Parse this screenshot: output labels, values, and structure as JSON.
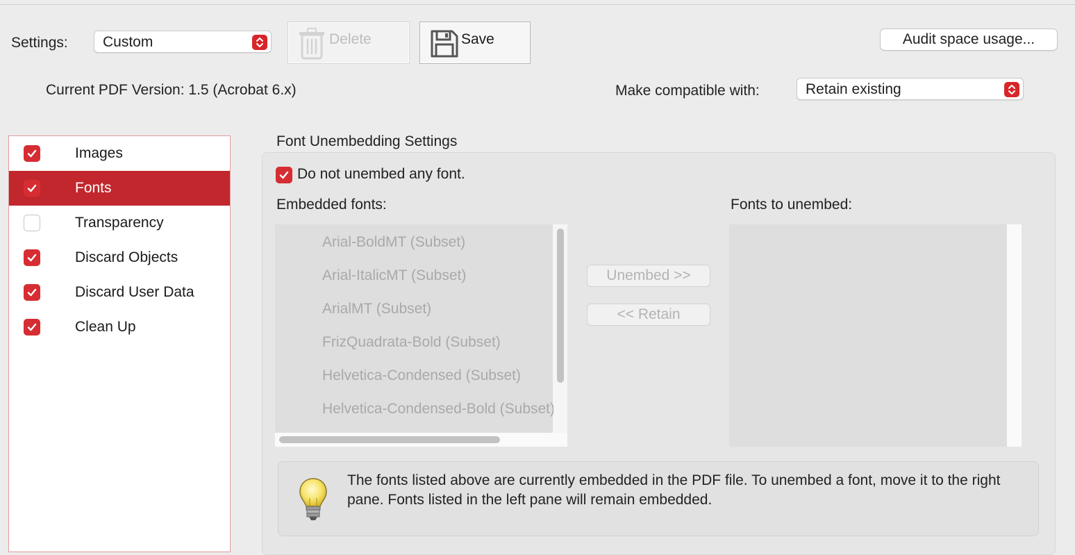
{
  "settings": {
    "label": "Settings:",
    "selected": "Custom",
    "delete_label": "Delete",
    "save_label": "Save",
    "audit_label": "Audit space usage..."
  },
  "pdf": {
    "current_version": "Current PDF Version: 1.5 (Acrobat 6.x)",
    "compat_label": "Make compatible with:",
    "compat_selected": "Retain existing"
  },
  "sidebar": {
    "items": [
      {
        "label": "Images",
        "checked": true,
        "selected": false
      },
      {
        "label": "Fonts",
        "checked": true,
        "selected": true
      },
      {
        "label": "Transparency",
        "checked": false,
        "selected": false
      },
      {
        "label": "Discard Objects",
        "checked": true,
        "selected": false
      },
      {
        "label": "Discard User Data",
        "checked": true,
        "selected": false
      },
      {
        "label": "Clean Up",
        "checked": true,
        "selected": false
      }
    ]
  },
  "fonts_panel": {
    "title": "Font Unembedding Settings",
    "do_not_unembed_label": "Do not unembed any font.",
    "do_not_unembed_checked": true,
    "embedded_label": "Embedded fonts:",
    "unembed_label": "Fonts to unembed:",
    "embedded_fonts": [
      "Arial-BoldMT (Subset)",
      "Arial-ItalicMT (Subset)",
      "ArialMT (Subset)",
      "FrizQuadrata-Bold (Subset)",
      "Helvetica-Condensed (Subset)",
      "Helvetica-Condensed-Bold (Subset)"
    ],
    "unembed_button": "Unembed >>",
    "retain_button": "<< Retain",
    "info_text": "The fonts listed above are currently embedded in the PDF file. To unembed a font, move it to the right pane. Fonts listed in the left pane will remain embedded."
  },
  "colors": {
    "accent": "#c1272d",
    "checkbox": "#d62d33"
  }
}
